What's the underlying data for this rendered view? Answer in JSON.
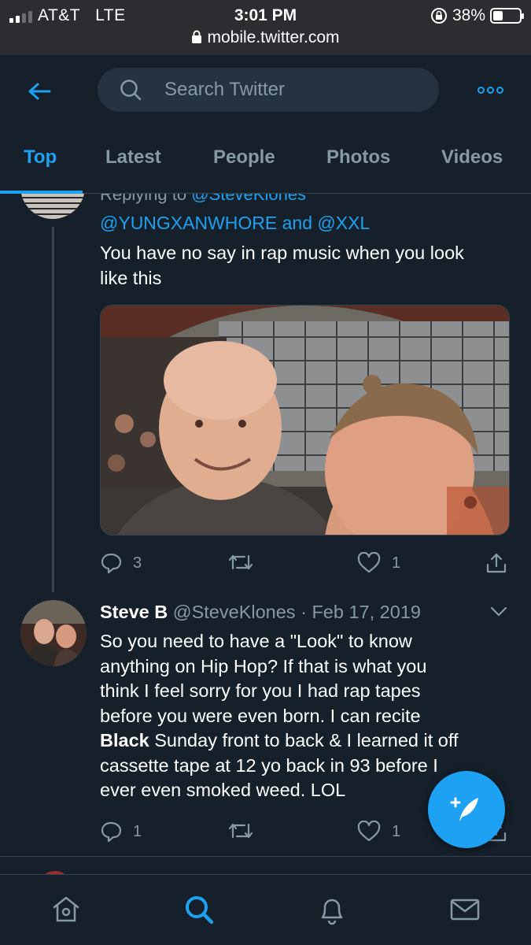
{
  "status_bar": {
    "carrier": "AT&T",
    "network": "LTE",
    "time": "3:01 PM",
    "battery_percent": "38%",
    "battery_level": 0.38,
    "url": "mobile.twitter.com"
  },
  "header": {
    "search_placeholder": "Search Twitter",
    "tabs": [
      {
        "label": "Top",
        "active": true
      },
      {
        "label": "Latest",
        "active": false
      },
      {
        "label": "People",
        "active": false
      },
      {
        "label": "Photos",
        "active": false
      },
      {
        "label": "Videos",
        "active": false
      }
    ]
  },
  "tweet1": {
    "replying_prefix": "Replying to",
    "replying_to": "@SteveKlones",
    "mention1": "@YUNGXANWHORE",
    "mention_joiner": "and",
    "mention2": "@XXL",
    "text_line1": "You have no say in rap music when you look",
    "text_line2": "like this",
    "replies": "3",
    "likes": "1"
  },
  "tweet2": {
    "name": "Steve B",
    "handle": "@SteveKlones",
    "separator": "·",
    "date": "Feb 17, 2019",
    "lines": [
      "So you need to have a \"Look\" to know",
      "anything on Hip Hop? If that is what you",
      "think I feel sorry for you I had rap tapes",
      "before you were even born. I can recite"
    ],
    "bold_word": "Black",
    "line5_rest": " Sunday front to back & I learned it off",
    "line6": "cassette tape at 12 yo back in 93 before I",
    "line7": "ever even smoked weed. LOL",
    "replies": "1",
    "likes": "1"
  },
  "icons": {
    "back": "arrow-left-icon",
    "search": "search-icon",
    "more": "more-icon",
    "reply": "reply-icon",
    "retweet": "retweet-icon",
    "like": "heart-icon",
    "share": "share-icon",
    "compose": "compose-icon",
    "home": "home-icon",
    "explore": "search-icon",
    "notifications": "bell-icon",
    "messages": "mail-icon"
  },
  "colors": {
    "background": "#15202b",
    "accent": "#1da1f2",
    "muted": "#8899a6",
    "border": "#38444d"
  }
}
